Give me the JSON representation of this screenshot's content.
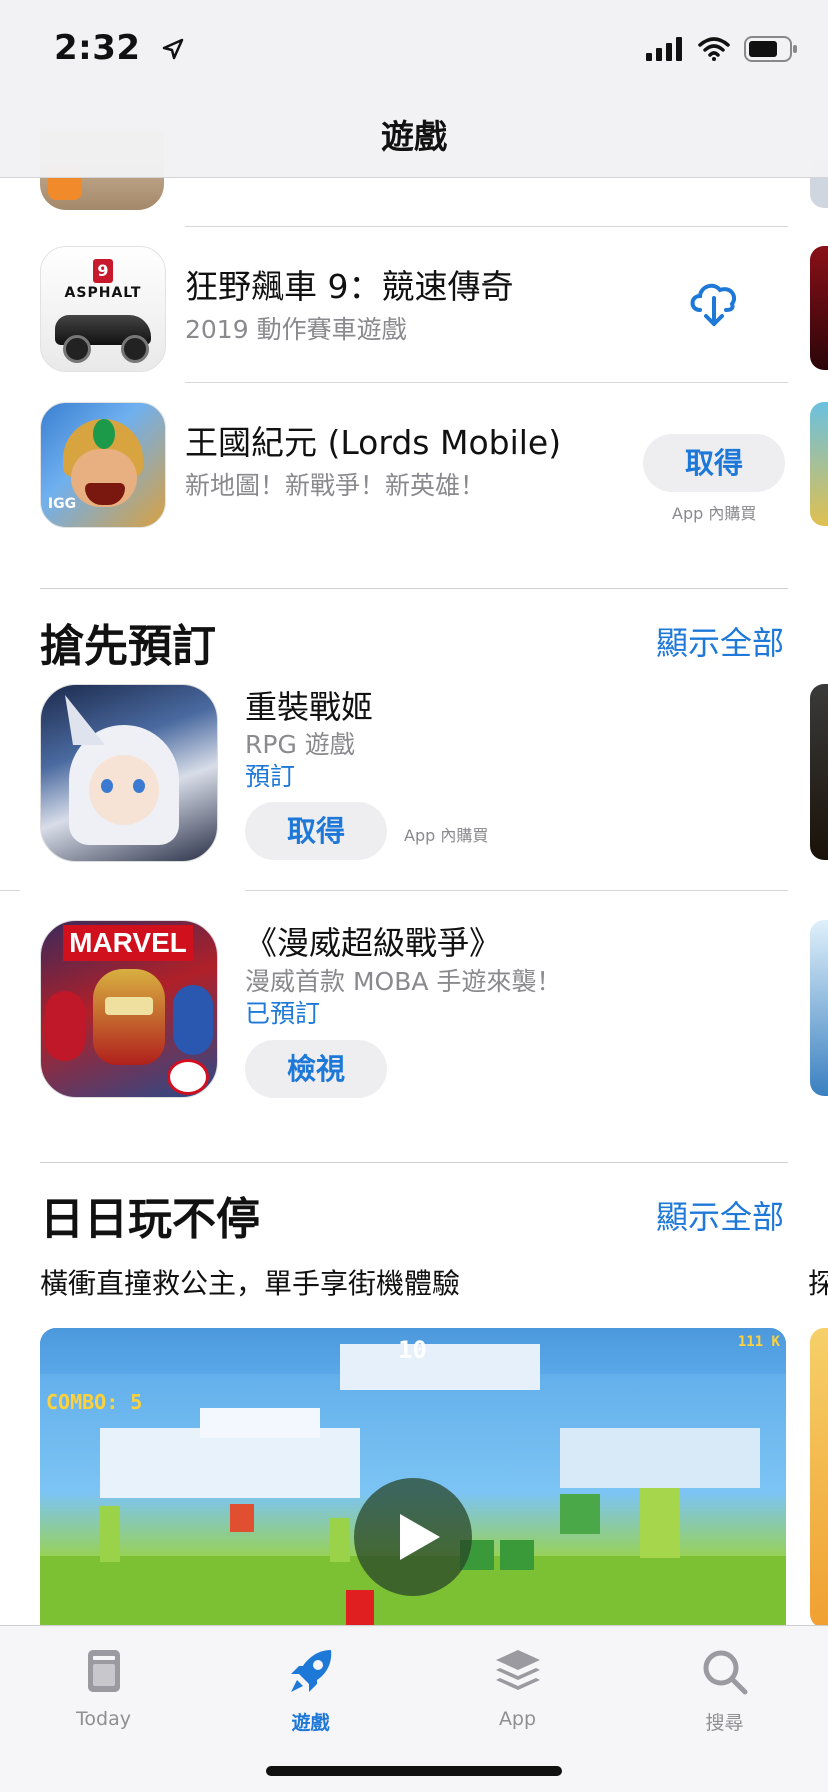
{
  "status_bar": {
    "time": "2:32"
  },
  "header": {
    "title": "遊戲"
  },
  "top_list": {
    "apps": [
      {
        "name": "狂野飆車 9：競速傳奇",
        "subtitle": "2019 動作賽車遊戲",
        "action": "download"
      },
      {
        "name": "王國紀元 (Lords Mobile)",
        "subtitle": "新地圖！新戰爭！新英雄！",
        "get_label": "取得",
        "iap_note": "App 內購買"
      }
    ]
  },
  "preorder_section": {
    "title": "搶先預訂",
    "see_all": "顯示全部",
    "items": [
      {
        "name": "重裝戰姬",
        "category": "RPG 遊戲",
        "status": "預訂",
        "button_label": "取得",
        "iap_note": "App 內購買"
      },
      {
        "name": "《漫威超級戰爭》",
        "category": "漫威首款 MOBA 手遊來襲！",
        "status": "已預訂",
        "button_label": "檢視"
      }
    ]
  },
  "daily_section": {
    "title": "日日玩不停",
    "see_all": "顯示全部",
    "subtitle": "橫衝直撞救公主，單手享街機體驗",
    "peek_char": "探",
    "video": {
      "combo_text": "COMBO: 5",
      "score": "10",
      "top_right": "111 K"
    }
  },
  "tab_bar": {
    "tabs": [
      {
        "label": "Today",
        "icon": "today-icon",
        "active": false
      },
      {
        "label": "遊戲",
        "icon": "rocket-icon",
        "active": true
      },
      {
        "label": "App",
        "icon": "layers-icon",
        "active": false
      },
      {
        "label": "搜尋",
        "icon": "search-icon",
        "active": false
      }
    ]
  },
  "colors": {
    "accent": "#1e78d8",
    "secondary_text": "#8a8a8e"
  }
}
